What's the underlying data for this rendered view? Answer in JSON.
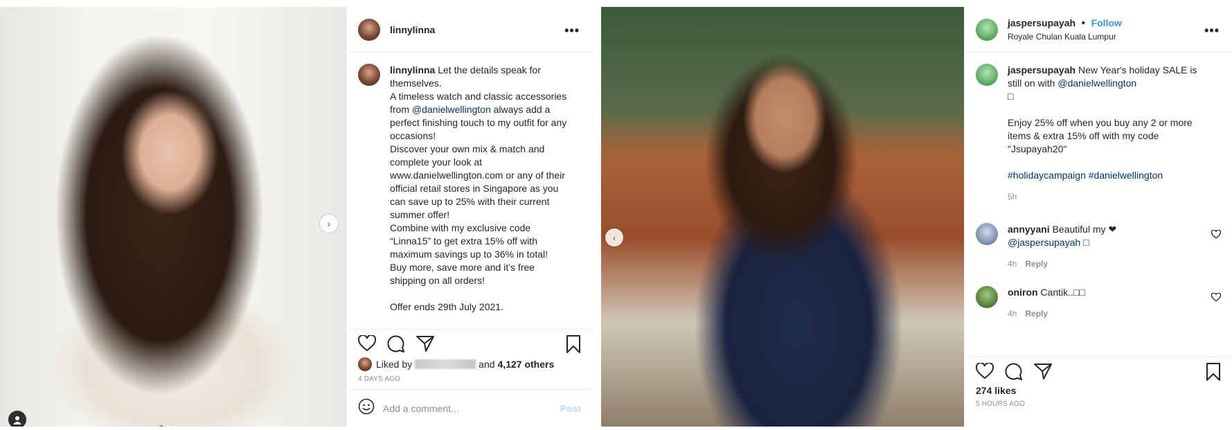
{
  "post1": {
    "username": "linnylinna",
    "more_icon": "•••",
    "caption_username": "linnylinna",
    "caption_lines": [
      " Let the details speak for themselves.",
      "A timeless watch and classic accessories from ",
      "@danielwellington",
      " always add a perfect finishing touch to my outfit for any occasions!",
      "Discover your own mix & match and complete your look at www.danielwellington.com or any of their official retail stores in Singapore as you can save up to 25% with their current summer offer!",
      "Combine with my exclusive code “Linna15” to get extra 15% off with maximum savings up to 36% in total!",
      "Buy more, save more and it’s free shipping on all orders!",
      "Offer ends 29th July 2021."
    ],
    "liked_by_prefix": "Liked by",
    "liked_by_suffix": "and",
    "liked_by_count": "4,127 others",
    "time_ago": "4 DAYS AGO",
    "add_comment_placeholder": "Add a comment...",
    "post_button": "Post",
    "next_arrow": "›"
  },
  "post2": {
    "username": "jaspersupayah",
    "follow": "Follow",
    "dot_sep": "•",
    "location": "Royale Chulan Kuala Lumpur",
    "more_icon": "•••",
    "caption_username": "jaspersupayah",
    "caption_part1": " New Year's holiday SALE is still on with ",
    "caption_mention": "@danielwellington",
    "caption_emoji": "□",
    "caption_part2": "Enjoy 25% off when you buy any 2 or more items & extra 15% off with my code \"Jsupayah20\"",
    "hashtags": "#holidaycampaign #danielwellington",
    "caption_time": "5h",
    "comments": [
      {
        "user": "annyyani",
        "text": " Beautiful my ❤ ",
        "mention": "@jaspersupayah",
        "emoji": " □",
        "time": "4h",
        "reply": "Reply"
      },
      {
        "user": "oniron",
        "text": " Cantik..□□",
        "time": "4h",
        "reply": "Reply"
      }
    ],
    "likes": "274 likes",
    "time_ago": "5 HOURS AGO",
    "prev_arrow": "‹"
  }
}
